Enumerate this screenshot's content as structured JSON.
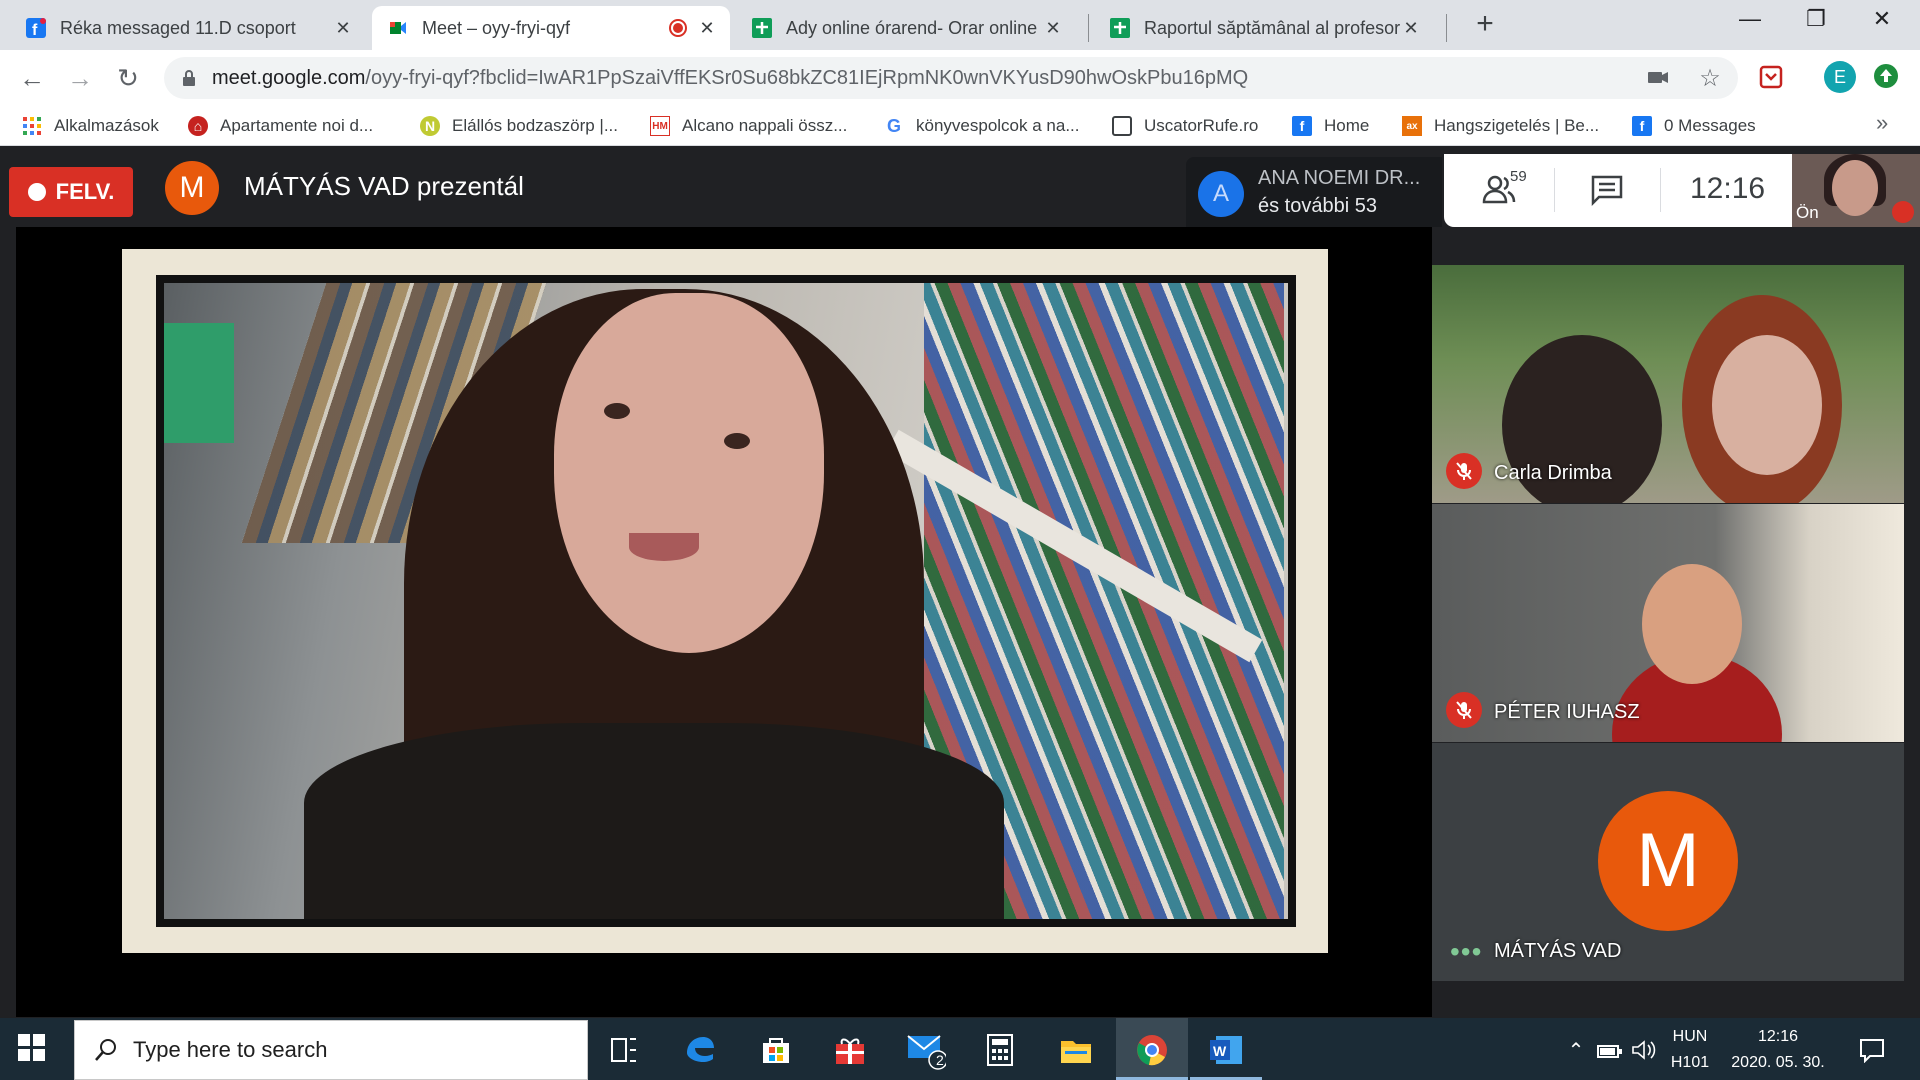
{
  "browser": {
    "tabs": [
      {
        "title": "Réka messaged 11.D csoport",
        "favicon": "facebook-icon"
      },
      {
        "title": "Meet – oyy-fryi-qyf",
        "favicon": "meet-icon",
        "active": true
      },
      {
        "title": "Ady online órarend- Orar online",
        "favicon": "sheets-icon"
      },
      {
        "title": "Raportul săptămânal al profesoril",
        "favicon": "sheets-icon"
      }
    ],
    "url_host": "meet.google.com",
    "url_rest": "/oyy-fryi-qyf?fbclid=IwAR1PpSzaiVffEKSr0Su68bkZC81IEjRpmNK0wnVKYusD90hwOskPbu16pMQ",
    "profile_initial": "E",
    "bookmarks": [
      {
        "label": "Alkalmazások",
        "icon": "apps-icon"
      },
      {
        "label": "Apartamente noi d...",
        "icon": "site-icon"
      },
      {
        "label": "Elállós bodzaszörp |...",
        "icon": "site-icon"
      },
      {
        "label": "Alcano nappali össz...",
        "icon": "site-icon"
      },
      {
        "label": "könyvespolcok a na...",
        "icon": "google-icon"
      },
      {
        "label": "UscatorRufe.ro",
        "icon": "site-icon"
      },
      {
        "label": "Home",
        "icon": "facebook-icon"
      },
      {
        "label": "Hangszigetelés | Be...",
        "icon": "site-icon"
      },
      {
        "label": "0 Messages",
        "icon": "facebook-icon"
      }
    ]
  },
  "meet": {
    "recording_label": "FELV.",
    "presenter_initial": "M",
    "presenter_text": "MÁTYÁS VAD prezentál",
    "joined": {
      "avatar": "A",
      "line1": "ANA NOEMI DR...",
      "line2": "és további 53"
    },
    "people_count": "59",
    "clock": "12:16",
    "self_label": "Ön",
    "tiles": [
      {
        "name": "Carla Drimba",
        "muted": true
      },
      {
        "name": "PÉTER IUHASZ",
        "muted": true
      },
      {
        "name": "MÁTYÁS VAD",
        "initial": "M",
        "speaking": true
      }
    ],
    "colors": {
      "recording": "#d93025",
      "avatar_orange": "#e8590c",
      "bg": "#202124"
    }
  },
  "taskbar": {
    "search_placeholder": "Type here to search",
    "mail_badge": "2",
    "lang": "HUN",
    "layout": "H101",
    "time": "12:16",
    "date": "2020. 05. 30."
  }
}
